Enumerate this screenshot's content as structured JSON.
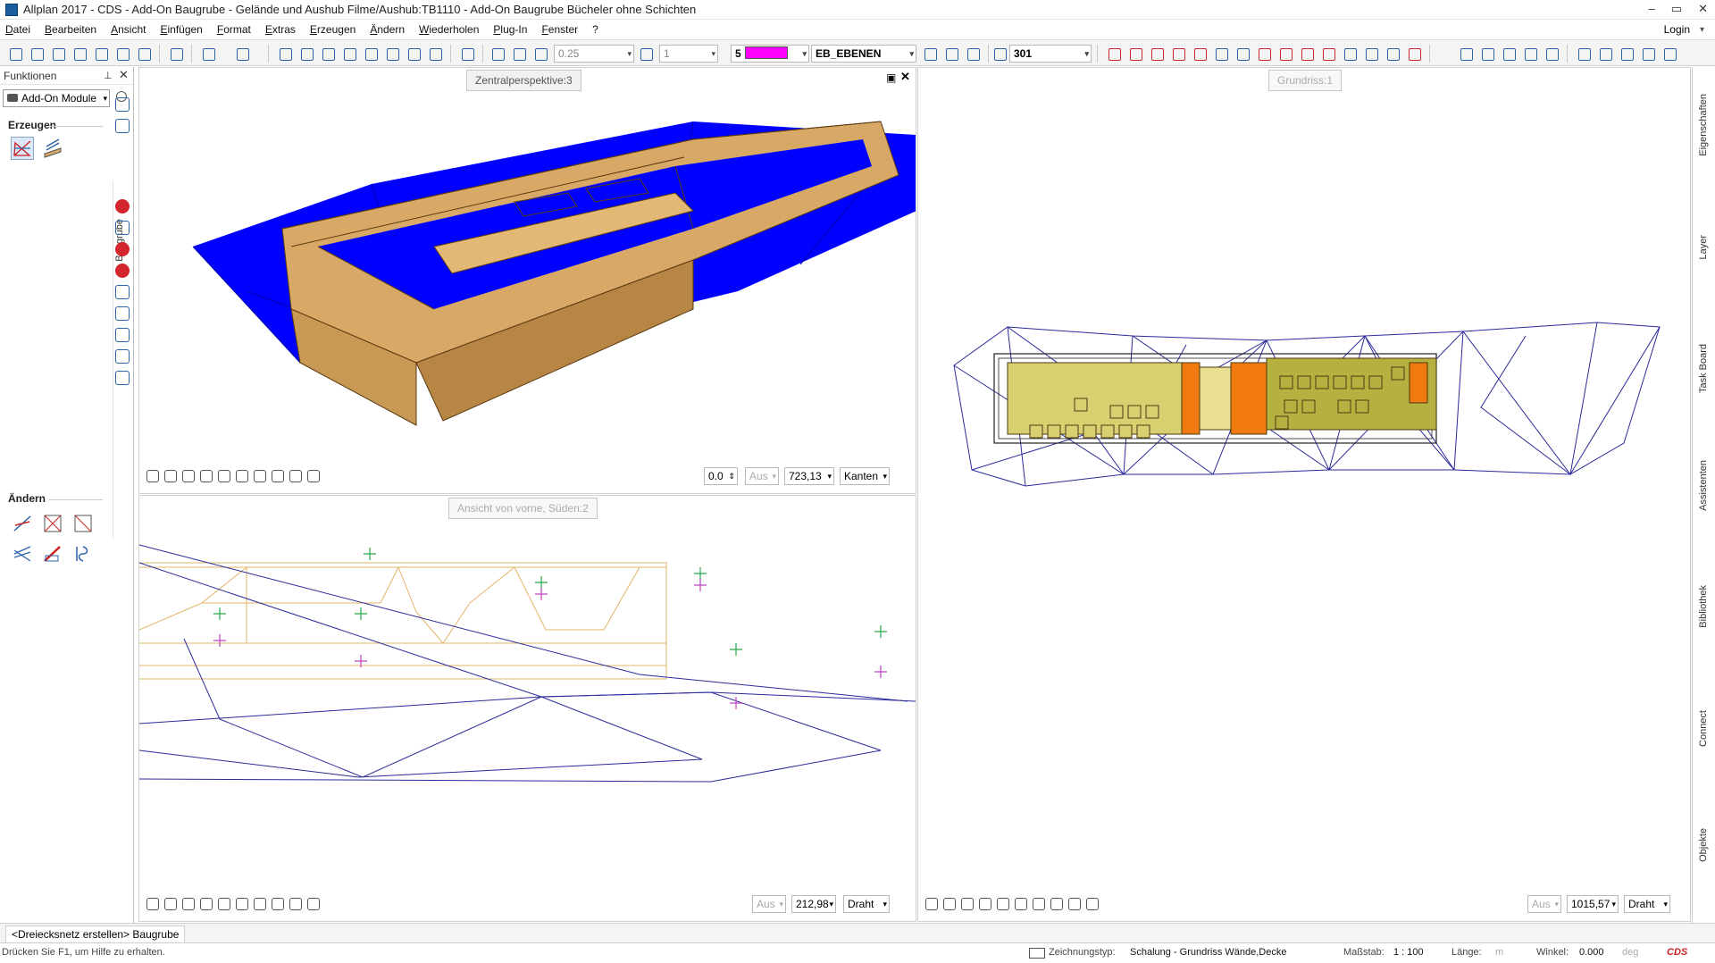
{
  "window": {
    "title": "Allplan 2017 - CDS - Add-On Baugrube - Gelände und Aushub Filme/Aushub:TB1110 - Add-On Baugrube Bücheler ohne Schichten",
    "min": "–",
    "max": "▭",
    "close": "✕"
  },
  "menu": {
    "items": [
      "Datei",
      "Bearbeiten",
      "Ansicht",
      "Einfügen",
      "Format",
      "Extras",
      "Erzeugen",
      "Ändern",
      "Wiederholen",
      "Plug-In",
      "Fenster",
      "?"
    ],
    "login": "Login"
  },
  "toolbar": {
    "line_weight": "0.25",
    "line_type": "1",
    "pen_number": "5",
    "pen_color": "#ff00ff",
    "layer": "EB_EBENEN",
    "hatch": "301"
  },
  "left_panel": {
    "title": "Funktionen",
    "module": "Add-On Module",
    "section_create": "Erzeugen",
    "section_modify": "Ändern",
    "vertical_tab": "Baugrube"
  },
  "viewports": {
    "perspective": {
      "label": "Zentralperspektive:3",
      "angle": "0.0",
      "aus": "Aus",
      "zoom": "723,13",
      "mode": "Kanten"
    },
    "front": {
      "label": "Ansicht von vorne, Süden:2",
      "aus": "Aus",
      "zoom": "212,98",
      "mode": "Draht"
    },
    "plan": {
      "label": "Grundriss:1",
      "aus": "Aus",
      "zoom": "1015,57",
      "mode": "Draht"
    }
  },
  "right_tabs": [
    "Eigenschaften",
    "Layer",
    "Task Board",
    "Assistenten",
    "Bibliothek",
    "Connect",
    "Objekte"
  ],
  "tab_bar": {
    "active_tab": "<Dreiecksnetz erstellen> Baugrube"
  },
  "status": {
    "hint": "Drücken Sie F1, um Hilfe zu erhalten.",
    "drawing_type_label": "Zeichnungstyp:",
    "drawing_type": "Schalung  -  Grundriss Wände,Decke",
    "scale_label": "Maßstab:",
    "scale": "1 : 100",
    "length_label": "Länge:",
    "length_unit": "m",
    "angle_label": "Winkel:",
    "angle": "0.000",
    "angle_unit": "deg",
    "brand": "CDS"
  },
  "colors": {
    "terrain": "#0000ff",
    "excavation": "#d8a966",
    "wire": "#2b2b9a",
    "section": "#e2b46a"
  }
}
